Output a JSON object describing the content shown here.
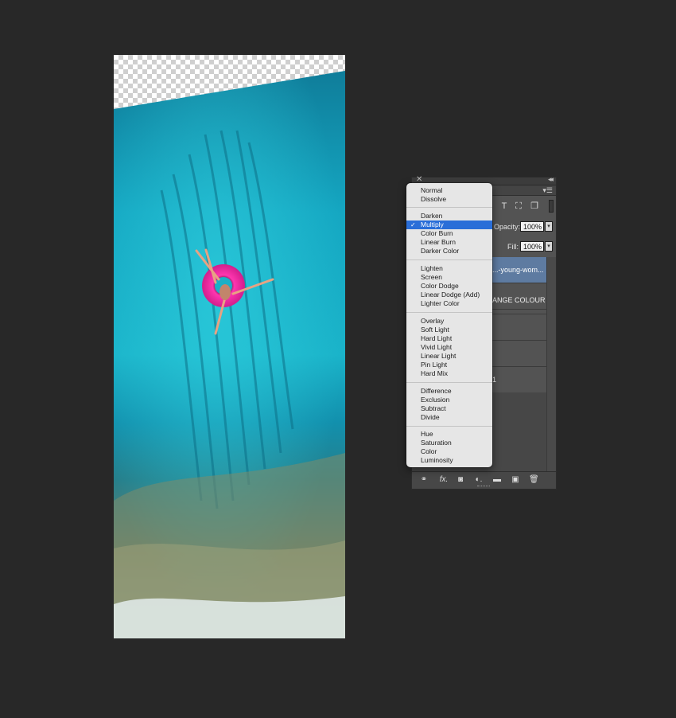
{
  "canvas": {
    "image_description_icon": "photo-canvas"
  },
  "layers_panel": {
    "opacity_label": "Opacity:",
    "opacity_value": "100%",
    "fill_label": "Fill:",
    "fill_value": "100%",
    "layers": [
      {
        "name": "...-young-wom...",
        "selected": true
      },
      {
        "name": "",
        "selected": false
      },
      {
        "name": "ANGE COLOUR",
        "selected": false
      },
      {
        "name": "",
        "selected": false
      },
      {
        "name": "",
        "selected": false
      },
      {
        "name": "1",
        "selected": false
      }
    ],
    "filter_icons": [
      "type-icon",
      "transform-icon",
      "smart-object-icon"
    ],
    "bottom_icons": [
      "link-icon",
      "fx-icon",
      "mask-icon",
      "adjustment-icon",
      "folder-icon",
      "new-layer-icon",
      "trash-icon"
    ]
  },
  "blend_menu": {
    "selected": "Multiply",
    "groups": [
      [
        "Normal",
        "Dissolve"
      ],
      [
        "Darken",
        "Multiply",
        "Color Burn",
        "Linear Burn",
        "Darker Color"
      ],
      [
        "Lighten",
        "Screen",
        "Color Dodge",
        "Linear Dodge (Add)",
        "Lighter Color"
      ],
      [
        "Overlay",
        "Soft Light",
        "Hard Light",
        "Vivid Light",
        "Linear Light",
        "Pin Light",
        "Hard Mix"
      ],
      [
        "Difference",
        "Exclusion",
        "Subtract",
        "Divide"
      ],
      [
        "Hue",
        "Saturation",
        "Color",
        "Luminosity"
      ]
    ]
  },
  "colors": {
    "workspace_bg": "#282828",
    "panel_bg": "#535353",
    "selection_blue": "#2a6ed8",
    "layer_selected": "#5e7ba1"
  }
}
